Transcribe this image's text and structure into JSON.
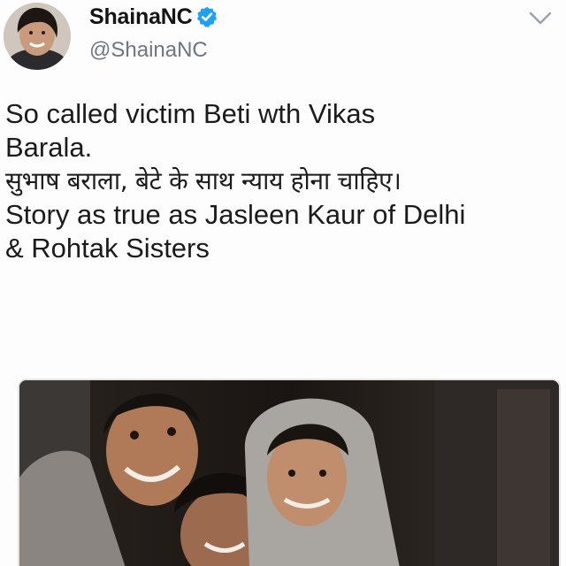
{
  "tweet": {
    "author": {
      "display_name": "ShainaNC",
      "handle": "@ShainaNC",
      "verified": true
    },
    "menu_icon": "chevron-down-icon",
    "text_lines": [
      "So called victim Beti wth Vikas",
      "Barala.",
      "सुभाष बराला, बेटे के साथ न्याय होना चाहिए।",
      "Story as true as Jasleen Kaur of Delhi",
      "& Rohtak Sisters"
    ],
    "media": {
      "type": "photo"
    }
  },
  "colors": {
    "verified_badge": "#1da1f2",
    "handle_text": "#6e7680",
    "body_text": "#1b1b1b"
  }
}
